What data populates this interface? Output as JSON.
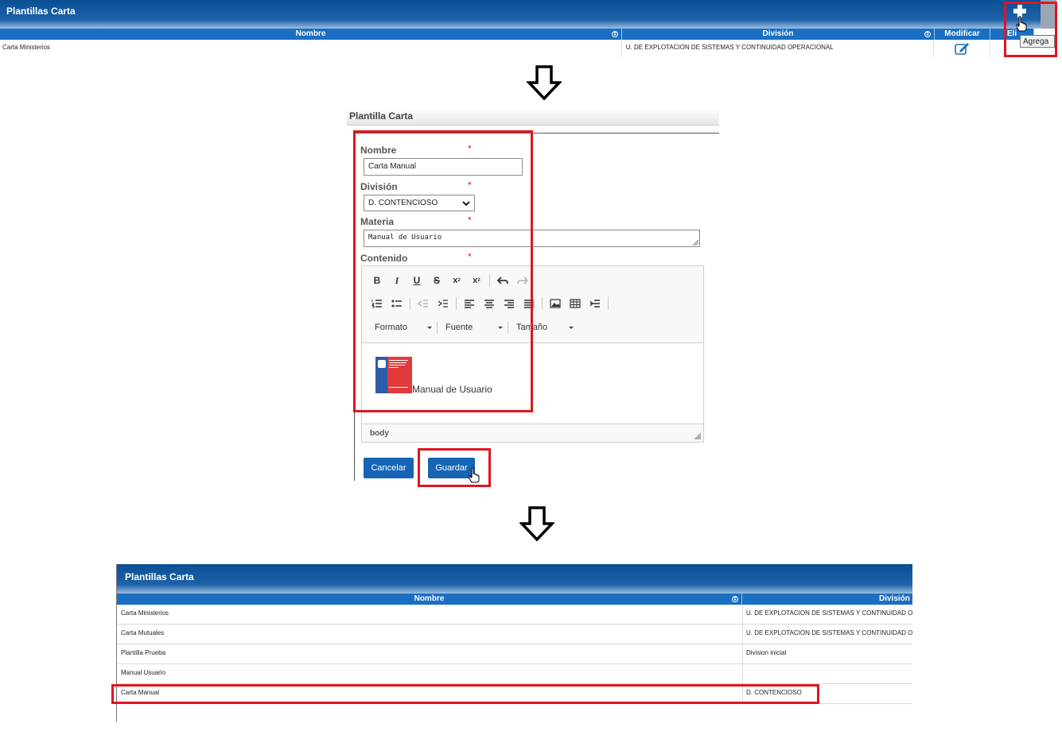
{
  "top_grid": {
    "title": "Plantillas Carta",
    "columns": {
      "nombre": "Nombre",
      "division": "División",
      "modificar": "Modificar",
      "eliminar": "Eli"
    },
    "rows": [
      {
        "nombre": "Carta Ministerios",
        "division": "U. DE EXPLOTACION DE SISTEMAS Y CONTINUIDAD OPERACIONAL"
      }
    ],
    "add_tooltip": "Agrega"
  },
  "form": {
    "title": "Plantilla Carta",
    "nombre_label": "Nombre",
    "nombre_value": "Carta Manual",
    "division_label": "División",
    "division_value": "D. CONTENCIOSO",
    "materia_label": "Materia",
    "materia_value": "Manual de Usuario",
    "contenido_label": "Contenido",
    "required_mark": "*",
    "toolbar": {
      "row1": [
        "bold-icon",
        "italic-icon",
        "underline-icon",
        "strikethrough-icon",
        "subscript-icon",
        "superscript-icon",
        "undo-icon",
        "redo-icon"
      ],
      "row2": [
        "numbered-list-icon",
        "bulleted-list-icon",
        "outdent-icon",
        "indent-icon",
        "align-left-icon",
        "align-center-icon",
        "align-right-icon",
        "justify-icon",
        "image-icon",
        "table-icon",
        "horizontal-line-icon"
      ],
      "formato": "Formato",
      "fuente": "Fuente",
      "tamano": "Tamaño"
    },
    "editor_content": "Manual de Usuario",
    "status_path": "body",
    "cancel_label": "Cancelar",
    "save_label": "Guardar"
  },
  "bottom_grid": {
    "title": "Plantillas Carta",
    "columns": {
      "nombre": "Nombre",
      "division": "División"
    },
    "rows": [
      {
        "nombre": "Carta Ministerios",
        "division": "U. DE EXPLOTACION DE SISTEMAS Y CONTINUIDAD OPERACIONAL"
      },
      {
        "nombre": "Carta Mutuales",
        "division": "U. DE EXPLOTACION DE SISTEMAS Y CONTINUIDAD OPERACIONAL"
      },
      {
        "nombre": "Plantilla Prueba",
        "division": "Division inicial"
      },
      {
        "nombre": "Manual Usuario",
        "division": ""
      },
      {
        "nombre": "Carta Manual",
        "division": "D. CONTENCIOSO"
      }
    ]
  },
  "colors": {
    "header_blue": "#0a4f94",
    "column_blue": "#1a6fc2",
    "highlight_red": "#e0151f",
    "button_blue": "#1565b4"
  }
}
